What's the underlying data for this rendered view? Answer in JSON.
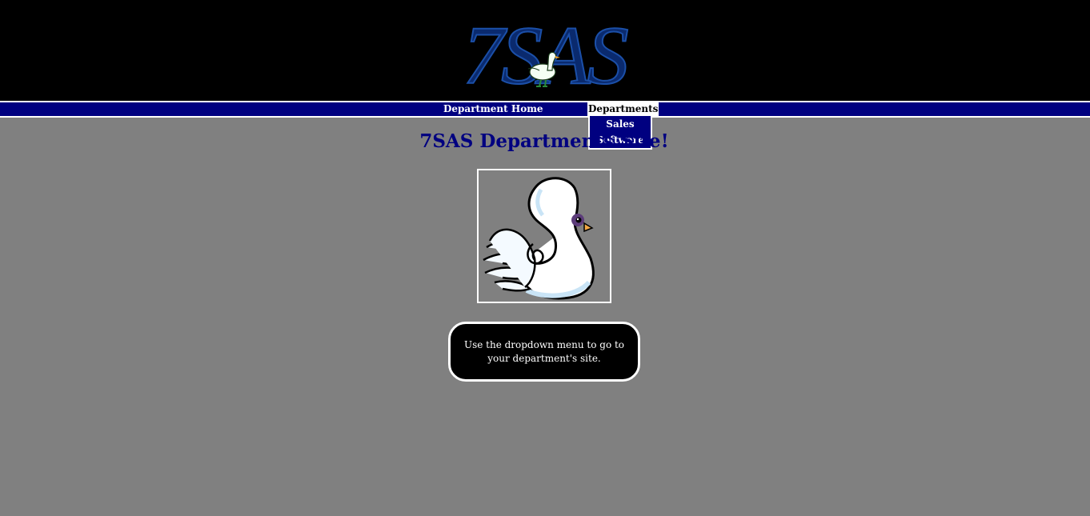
{
  "header": {
    "logo_text": "7SAS"
  },
  "nav": {
    "home_label": "Department Home",
    "departments_label": "Departments",
    "dropdown": [
      {
        "label": "Sales"
      },
      {
        "label": "Software"
      }
    ]
  },
  "main": {
    "title": "7SAS Departments Site!",
    "info_text": "Use the dropdown menu to go to your department's site."
  },
  "colors": {
    "background": "#808080",
    "header": "#000000",
    "nav": "#000080",
    "title": "#000080",
    "logo": "#0a2a6e"
  },
  "icons": {
    "logo_mascot": "goose-icon",
    "main_image": "swan-image"
  }
}
